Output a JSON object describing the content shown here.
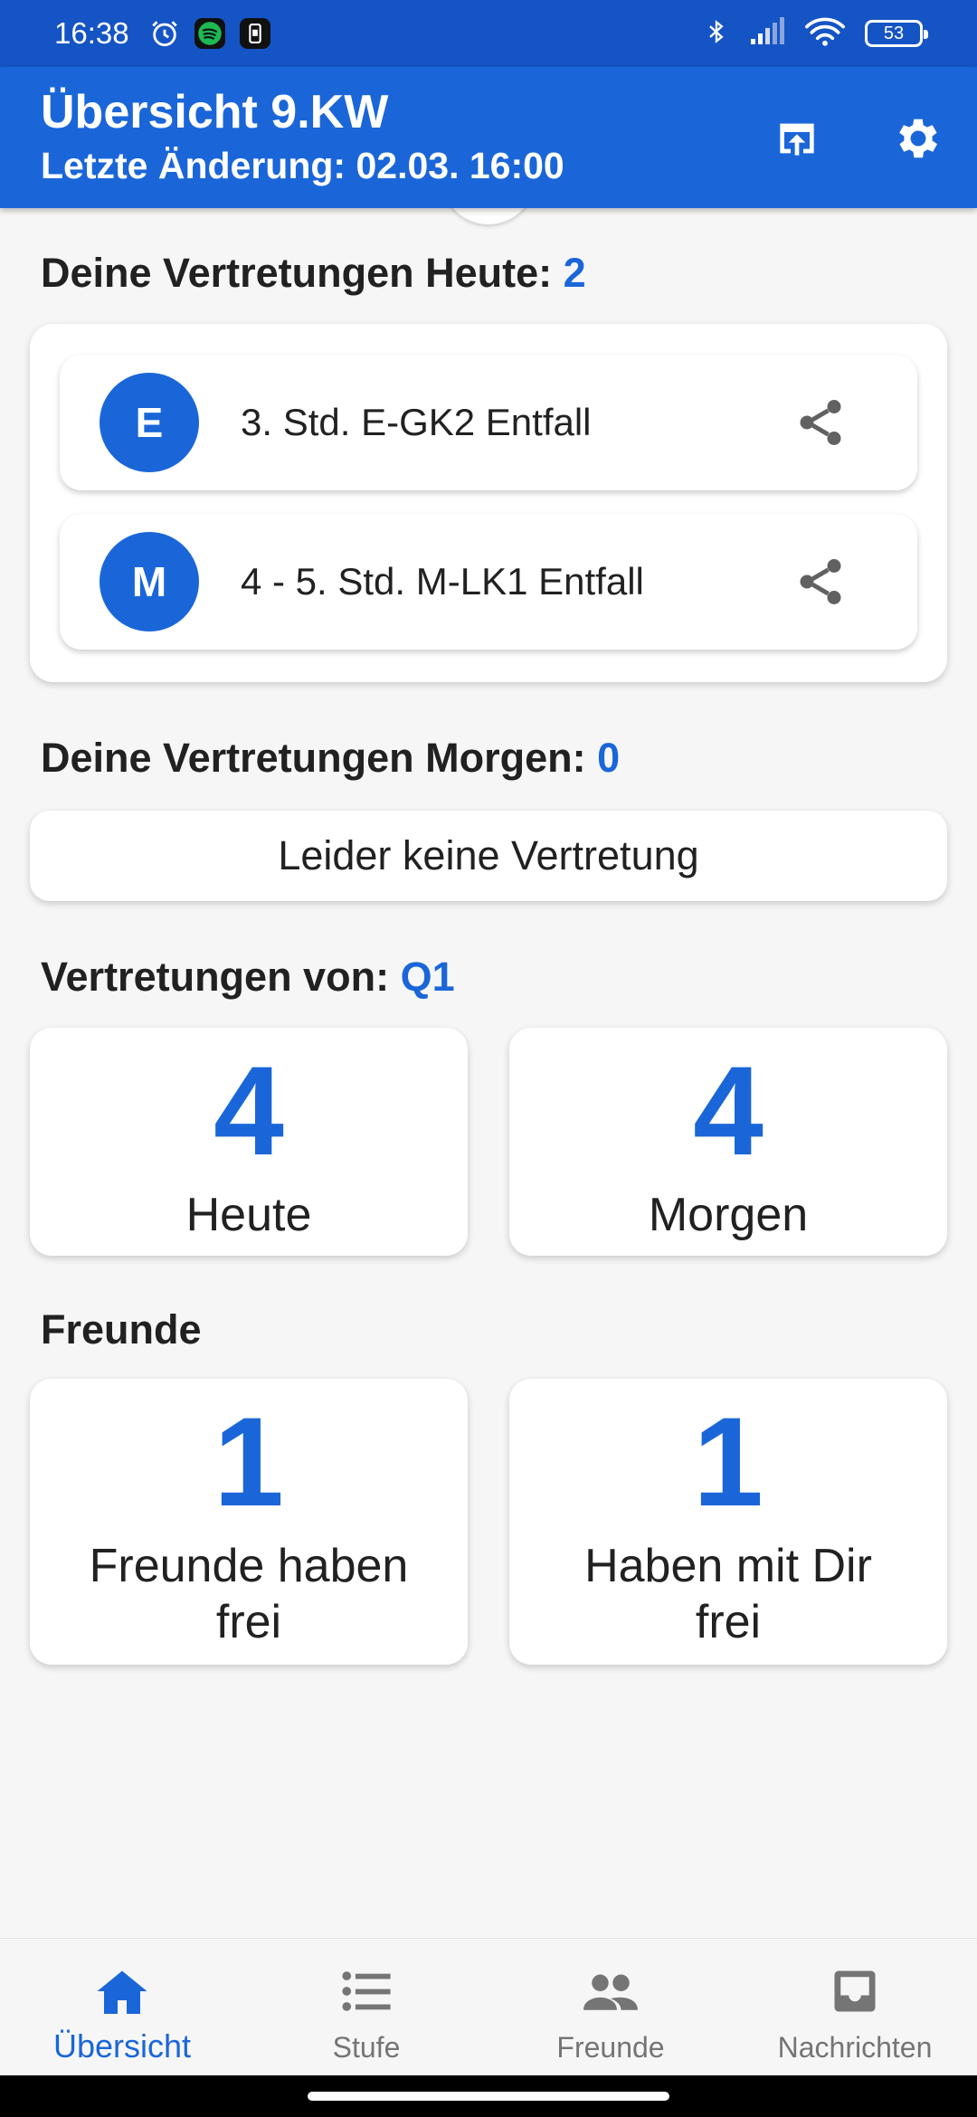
{
  "status_bar": {
    "time": "16:38",
    "battery": "53"
  },
  "app_bar": {
    "title": "Übersicht 9.KW",
    "subtitle": "Letzte Änderung: 02.03. 16:00"
  },
  "today": {
    "label": "Deine Vertretungen Heute:",
    "count": "2",
    "entries": [
      {
        "initial": "E",
        "text": "3. Std. E-GK2 Entfall"
      },
      {
        "initial": "M",
        "text": "4 - 5. Std. M-LK1 Entfall"
      }
    ]
  },
  "tomorrow": {
    "label": "Deine Vertretungen Morgen:",
    "count": "0",
    "empty_text": "Leider keine Vertretung"
  },
  "grade": {
    "label": "Vertretungen von:",
    "name": "Q1",
    "stats": [
      {
        "value": "4",
        "label": "Heute"
      },
      {
        "value": "4",
        "label": "Morgen"
      }
    ]
  },
  "friends": {
    "label": "Freunde",
    "stats": [
      {
        "value": "1",
        "label": "Freunde haben frei"
      },
      {
        "value": "1",
        "label": "Haben mit Dir frei"
      }
    ]
  },
  "bottom_nav": [
    {
      "label": "Übersicht",
      "icon": "home-icon",
      "active": true
    },
    {
      "label": "Stufe",
      "icon": "list-icon",
      "active": false
    },
    {
      "label": "Freunde",
      "icon": "people-icon",
      "active": false
    },
    {
      "label": "Nachrichten",
      "icon": "inbox-icon",
      "active": false
    }
  ],
  "colors": {
    "primary": "#1a66d9",
    "status_bar": "#1554c4",
    "background": "#f6f6f6",
    "inactive": "#757575"
  }
}
